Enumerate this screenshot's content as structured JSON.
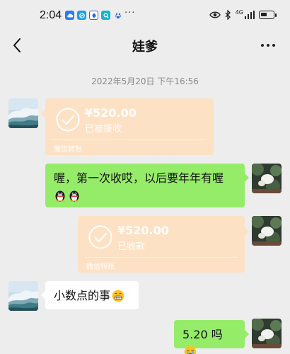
{
  "status_bar": {
    "time": "2:04",
    "dots": "···",
    "signal_label": "4G",
    "app_icons": [
      "cloud-app-icon",
      "browser-app-icon",
      "qq-app-icon",
      "search-app-icon",
      "baidu-app-icon"
    ]
  },
  "header": {
    "title": "娃爹"
  },
  "chat": {
    "timestamp": "2022年5月20日 下午16:56",
    "messages": [
      {
        "type": "transfer",
        "side": "left",
        "amount": "¥520.00",
        "status": "已被接收",
        "footer": "微信转账"
      },
      {
        "type": "text",
        "side": "right",
        "text": "喔，第一次收哎，以后要年年有喔",
        "emojis": [
          "penguin-emoji",
          "penguin-emoji"
        ]
      },
      {
        "type": "transfer",
        "side": "right",
        "amount": "¥520.00",
        "status": "已收款",
        "footer": "微信转账"
      },
      {
        "type": "text",
        "side": "left",
        "text": "小数点的事",
        "emojis": [
          "grimace-emoji"
        ]
      },
      {
        "type": "text",
        "side": "right",
        "text": "5.20 吗",
        "emojis": [
          "crying-emoji"
        ]
      }
    ]
  },
  "colors": {
    "background": "#ededed",
    "transfer_card": "#fde1c4",
    "own_bubble": "#95ec69",
    "other_bubble": "#ffffff"
  }
}
